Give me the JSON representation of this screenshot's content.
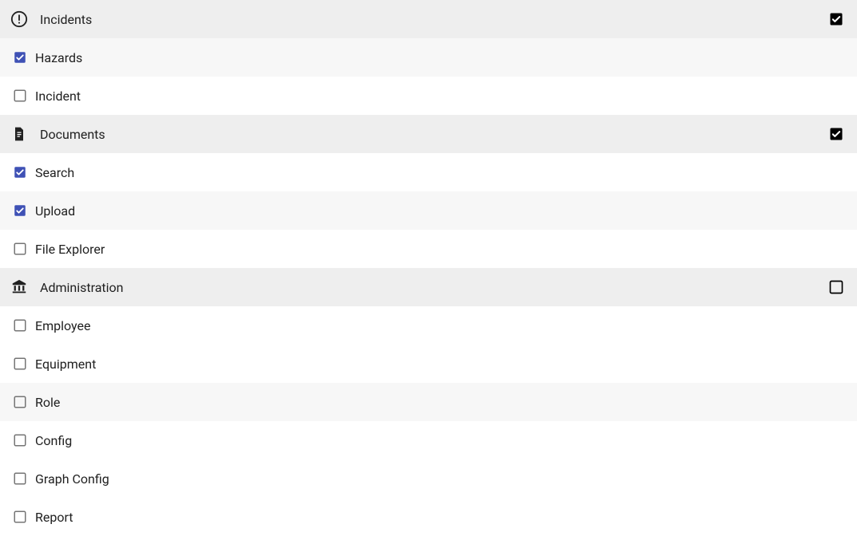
{
  "colors": {
    "header_bg": "#eeeeee",
    "stripe_bg": "#f7f7f7",
    "checkbox_checked": "#3f51b5",
    "checkbox_unchecked": "#757575",
    "section_check_checked": "#000000",
    "icon_fill": "#212121"
  },
  "sections": [
    {
      "key": "incidents",
      "title": "Incidents",
      "icon": "alert-circle-icon",
      "checked": true,
      "items": [
        {
          "label": "Hazards",
          "checked": true,
          "stripe": true
        },
        {
          "label": "Incident",
          "checked": false,
          "stripe": false
        }
      ]
    },
    {
      "key": "documents",
      "title": "Documents",
      "icon": "document-icon",
      "checked": true,
      "items": [
        {
          "label": "Search",
          "checked": true,
          "stripe": false
        },
        {
          "label": "Upload",
          "checked": true,
          "stripe": true
        },
        {
          "label": "File Explorer",
          "checked": false,
          "stripe": false
        }
      ]
    },
    {
      "key": "administration",
      "title": "Administration",
      "icon": "bank-icon",
      "checked": false,
      "items": [
        {
          "label": "Employee",
          "checked": false,
          "stripe": false
        },
        {
          "label": "Equipment",
          "checked": false,
          "stripe": false
        },
        {
          "label": "Role",
          "checked": false,
          "stripe": true
        },
        {
          "label": "Config",
          "checked": false,
          "stripe": false
        },
        {
          "label": "Graph Config",
          "checked": false,
          "stripe": false
        },
        {
          "label": "Report",
          "checked": false,
          "stripe": false
        }
      ]
    }
  ]
}
